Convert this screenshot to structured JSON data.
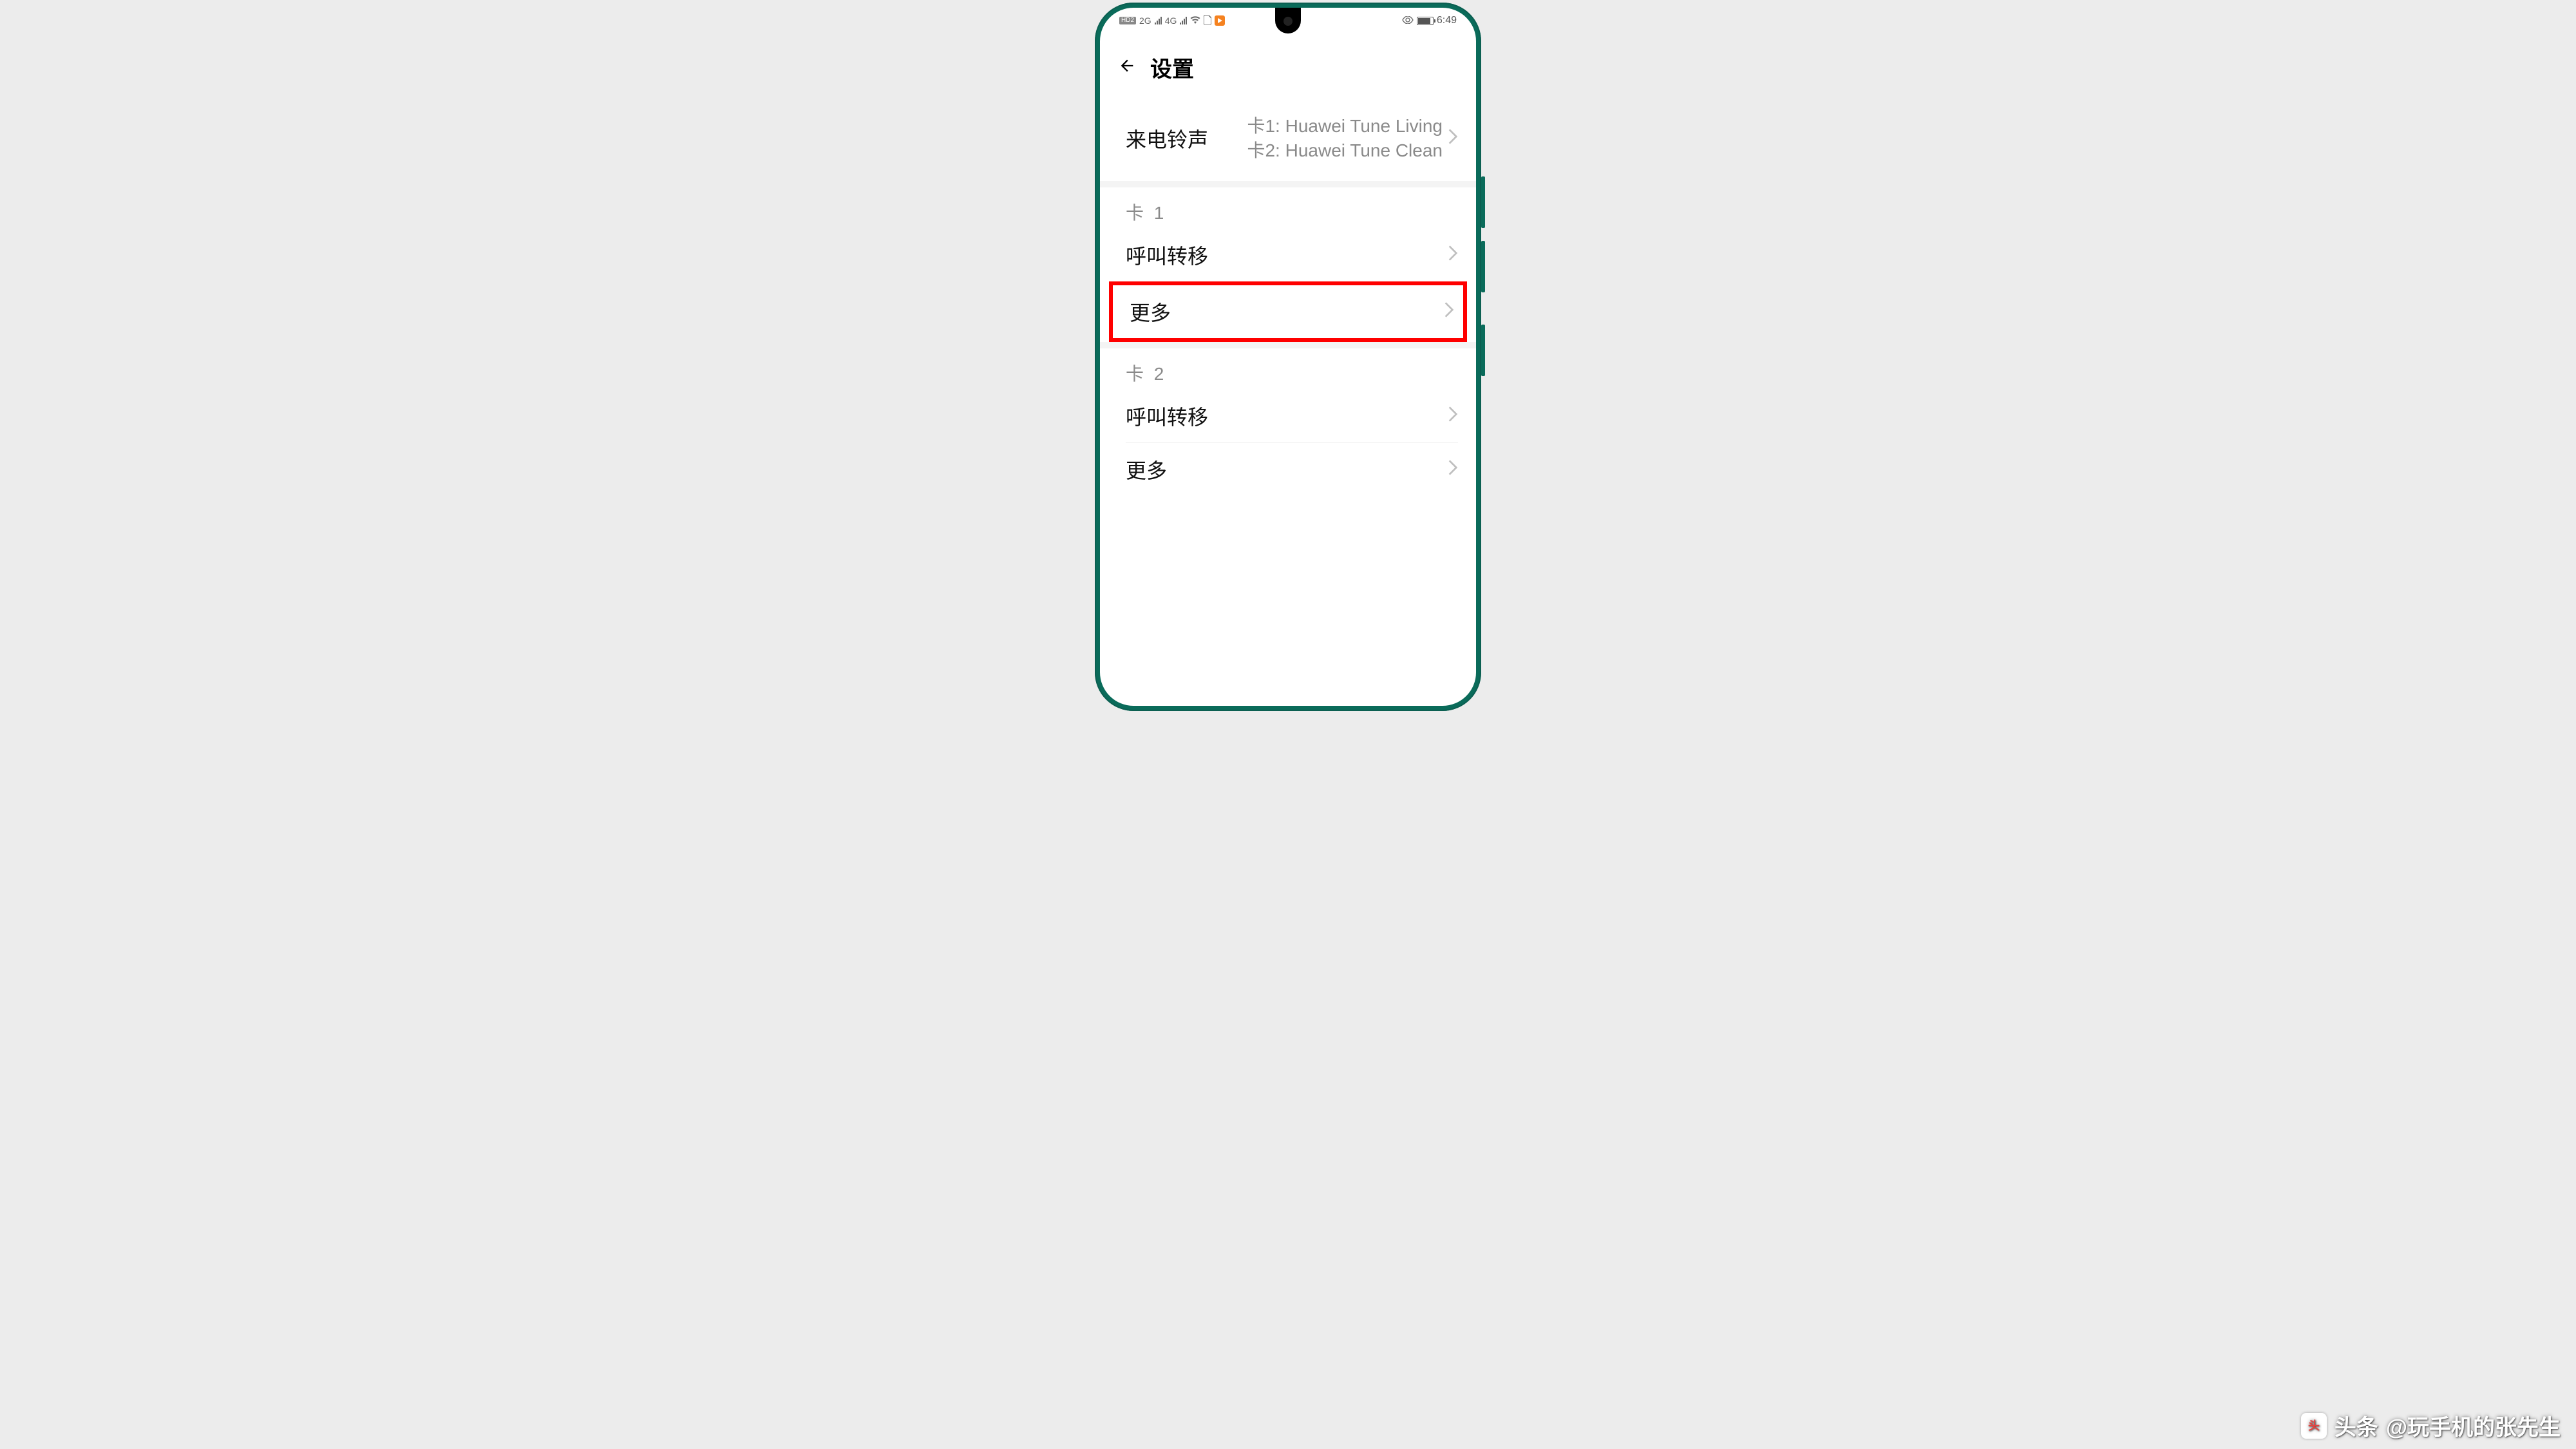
{
  "status": {
    "hd_badge": "HD2",
    "net1_label": "2G",
    "net2_label": "4G",
    "time": "6:49"
  },
  "header": {
    "title": "设置"
  },
  "ringtone": {
    "label": "来电铃声",
    "sim1": "卡1: Huawei Tune Living",
    "sim2": "卡2: Huawei Tune Clean"
  },
  "sections": [
    {
      "title": "卡 1",
      "items": [
        {
          "label": "呼叫转移",
          "highlight": false
        },
        {
          "label": "更多",
          "highlight": true
        }
      ]
    },
    {
      "title": "卡 2",
      "items": [
        {
          "label": "呼叫转移",
          "highlight": false
        },
        {
          "label": "更多",
          "highlight": false
        }
      ]
    }
  ],
  "watermark": {
    "brand": "头条",
    "handle": "@玩手机的张先生"
  }
}
